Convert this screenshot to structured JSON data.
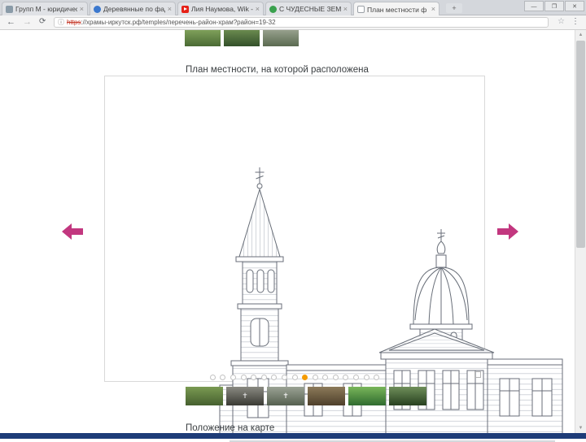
{
  "colors": {
    "accent": "#c2377f",
    "dot-active": "#f59b00",
    "taskbar": "#1e3c78",
    "yt-red": "#e62117",
    "fav1": "#8a9ba8",
    "fav2": "#3b78ce",
    "fav4": "#3aa14e",
    "fav5": "#9aa0a6"
  },
  "browser": {
    "tabs": [
      {
        "title": "Групп М - юридическ…"
      },
      {
        "title": "Деревянные по фадми…"
      },
      {
        "title": "Лия Наумова, Wik - Yo…"
      },
      {
        "title": "С ЧУДЕСНЫЕ ЗЕМЛИ ПЕР…"
      },
      {
        "title": "План местности ф - Бурят…"
      }
    ],
    "tab_close": "×",
    "new_tab": "+",
    "window": {
      "minimize": "—",
      "maximize": "❐",
      "close": "✕"
    },
    "nav": {
      "back": "←",
      "forward": "→",
      "refresh": "⟳"
    },
    "address": {
      "info": "ⓘ",
      "scheme": "https",
      "url": "://храмы-иркутск.рф/temples/перечень-район-храм?район=19-32",
      "star": "☆",
      "menu": "⋮"
    },
    "scroll_up": "▲",
    "scroll_down": "▼"
  },
  "page": {
    "heading_top": "План местности, на которой расположена",
    "heading_bottom": "Положение на карте",
    "carousel": {
      "dots_total": 17,
      "active_index": 10
    },
    "thumbs_top": [
      {
        "c1": "#7fa05a",
        "c2": "#4a6a34"
      },
      {
        "c1": "#6a8a4f",
        "c2": "#33502a"
      },
      {
        "c1": "#97a08c",
        "c2": "#5a6a50"
      }
    ],
    "thumbs_bottom": [
      {
        "c1": "#7a9a52",
        "c2": "#46602f"
      },
      {
        "c1": "#8a8a82",
        "c2": "#3a3a34",
        "ov": "✝",
        "ovc": "#dddddd"
      },
      {
        "c1": "#9aa294",
        "c2": "#55604f",
        "ov": "✝",
        "ovc": "#eeeeee"
      },
      {
        "c1": "#8c7a5a",
        "c2": "#4e3f2a"
      },
      {
        "c1": "#79b65a",
        "c2": "#2f6b2f"
      },
      {
        "c1": "#6f8f5a",
        "c2": "#27401f"
      }
    ]
  }
}
